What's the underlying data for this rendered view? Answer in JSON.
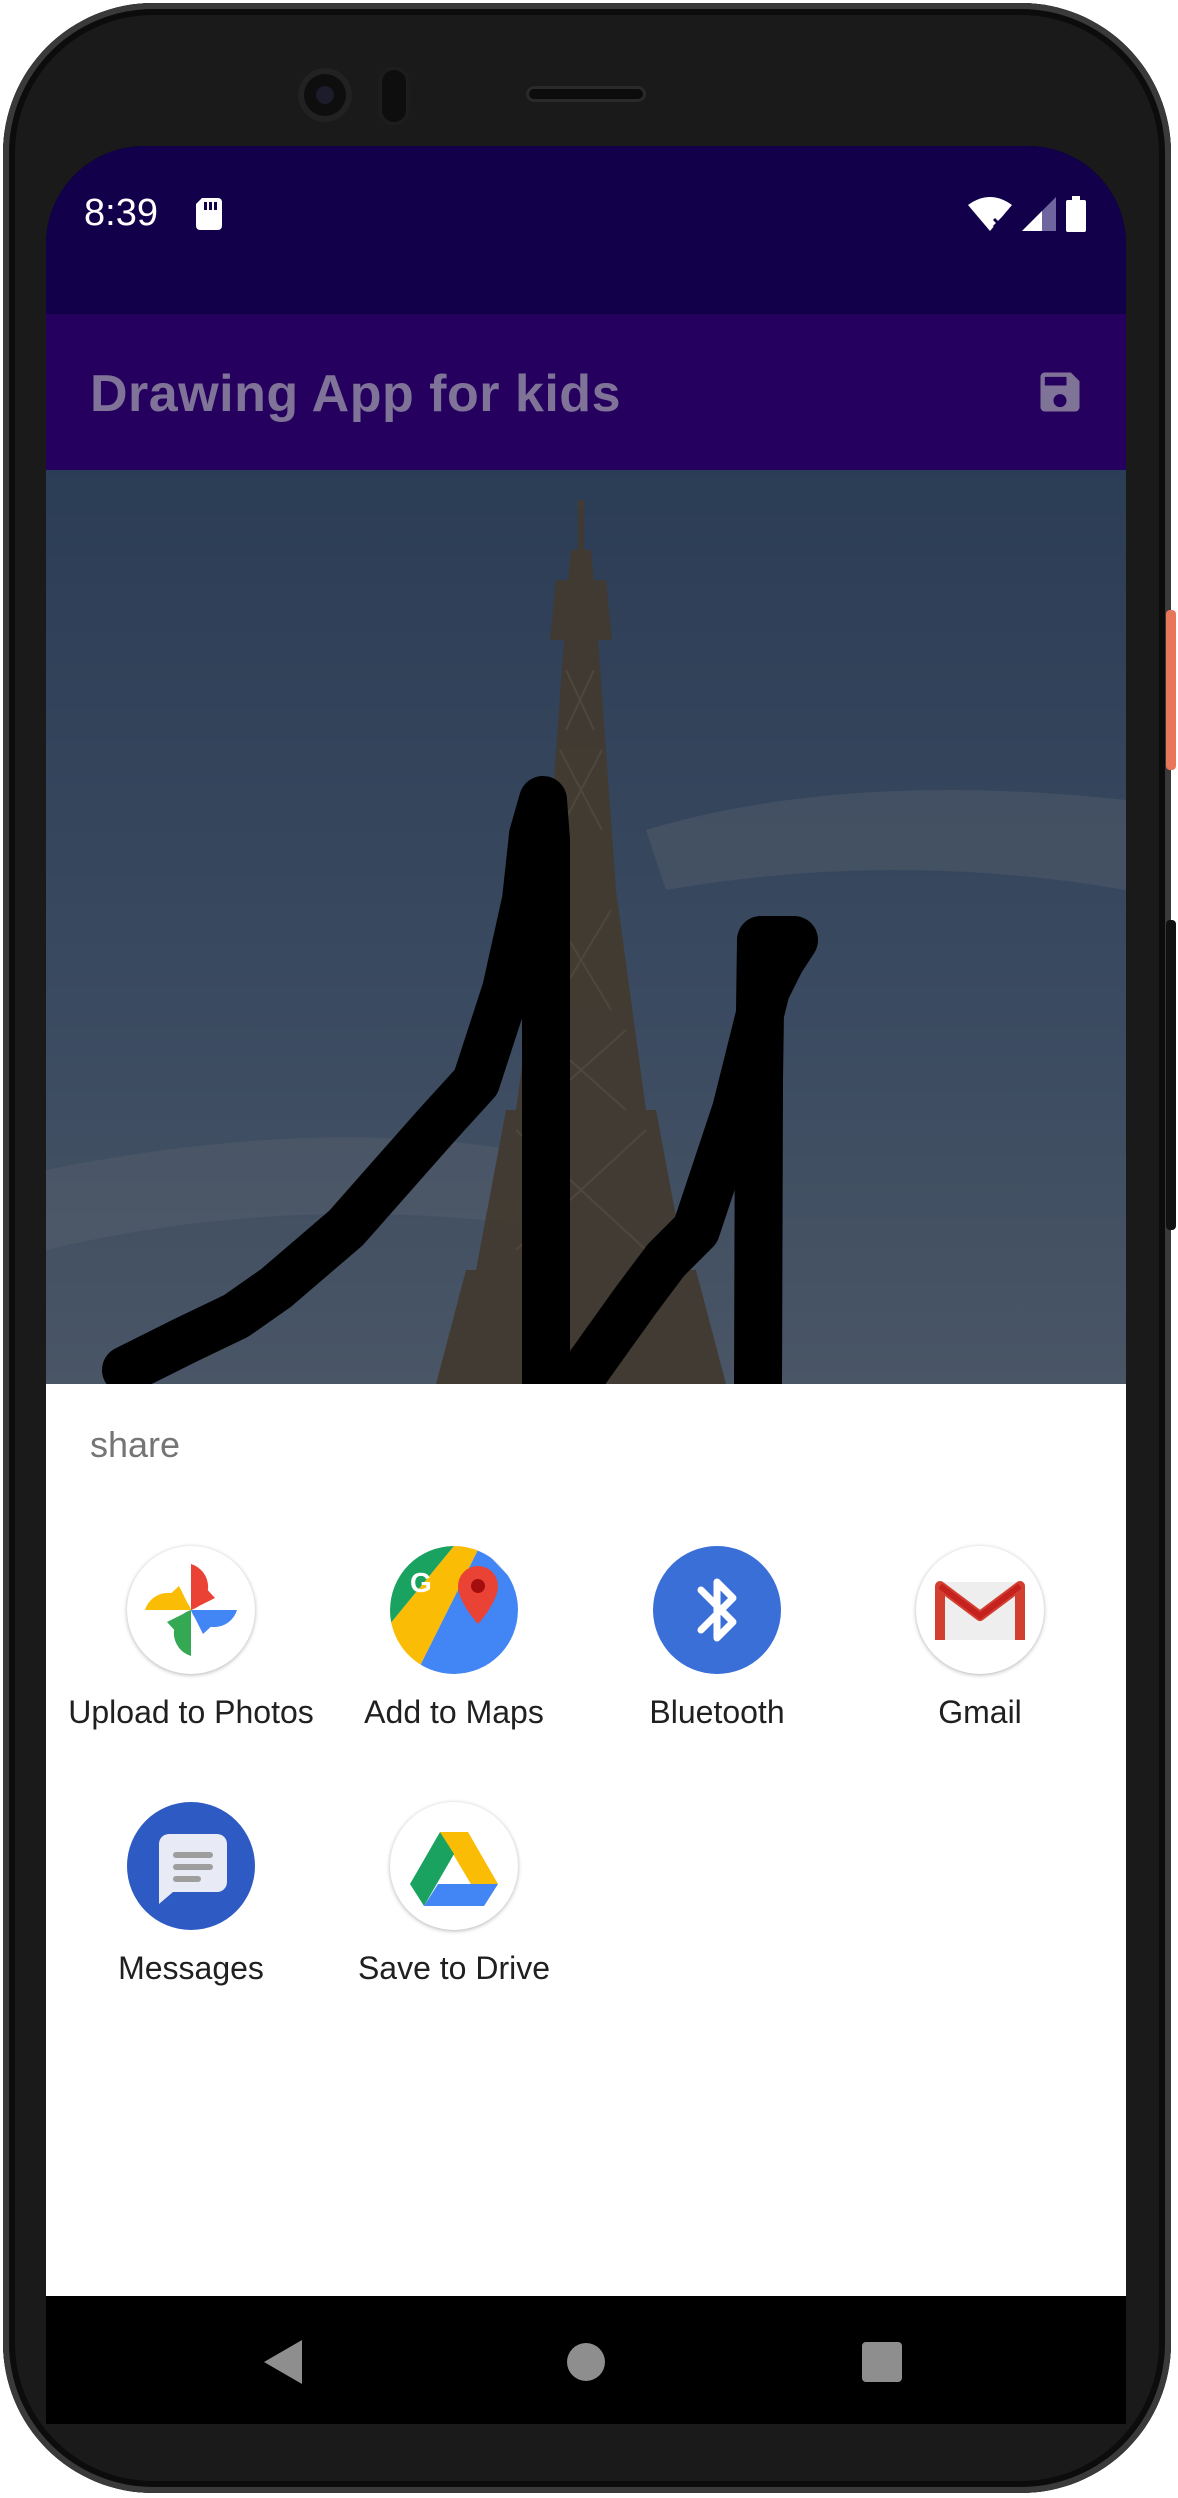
{
  "status_bar": {
    "time": "8:39"
  },
  "app_bar": {
    "title": "Drawing App for kids"
  },
  "share_sheet": {
    "title": "share",
    "targets": [
      {
        "label": "Upload to Photos",
        "icon": "google-photos-icon"
      },
      {
        "label": "Add to Maps",
        "icon": "google-maps-icon"
      },
      {
        "label": "Bluetooth",
        "icon": "bluetooth-icon"
      },
      {
        "label": "Gmail",
        "icon": "gmail-icon"
      },
      {
        "label": "Messages",
        "icon": "messages-icon"
      },
      {
        "label": "Save to Drive",
        "icon": "google-drive-icon"
      }
    ]
  },
  "colors": {
    "status_bar": "#13004a",
    "app_bar": "#25005f",
    "sheet_background": "#ffffff"
  }
}
